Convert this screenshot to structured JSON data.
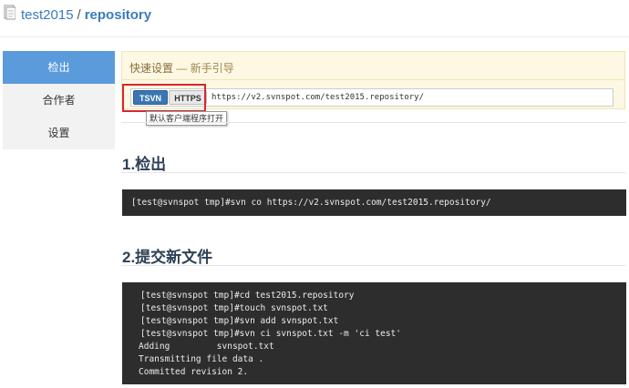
{
  "header": {
    "owner": "test2015",
    "separator": "/",
    "repo": "repository",
    "icon": "repo-book-icon"
  },
  "sidebar": {
    "items": [
      {
        "label": "检出",
        "active": true
      },
      {
        "label": "合作者",
        "active": false
      },
      {
        "label": "设置",
        "active": false
      }
    ]
  },
  "quick_setup": {
    "title": "快速设置",
    "subtitle": "— 新手引导",
    "tsvn_label": "TSVN",
    "https_label": "HTTPS",
    "url": "https://v2.svnspot.com/test2015.repository/",
    "tooltip": "默认客户端程序打开"
  },
  "sections": {
    "checkout": {
      "title": "1.检出",
      "lines": [
        "[test@svnspot tmp]#svn co https://v2.svnspot.com/test2015.repository/"
      ]
    },
    "commit": {
      "title": "2.提交新文件",
      "lines": [
        "[test@svnspot tmp]#cd test2015.repository",
        "[test@svnspot tmp]#touch svnspot.txt",
        "[test@svnspot tmp]#svn add svnspot.txt",
        "[test@svnspot tmp]#svn ci svnspot.txt -m 'ci test'",
        "Adding         svnspot.txt",
        "Transmitting file data .",
        "Committed revision 2."
      ]
    }
  },
  "colors": {
    "accent": "#3a7bbd",
    "sidebar_active": "#5b9bdc",
    "highlight_box": "#d9262c",
    "code_bg": "#2d2d2d",
    "notice_bg": "#fcf8e3"
  }
}
